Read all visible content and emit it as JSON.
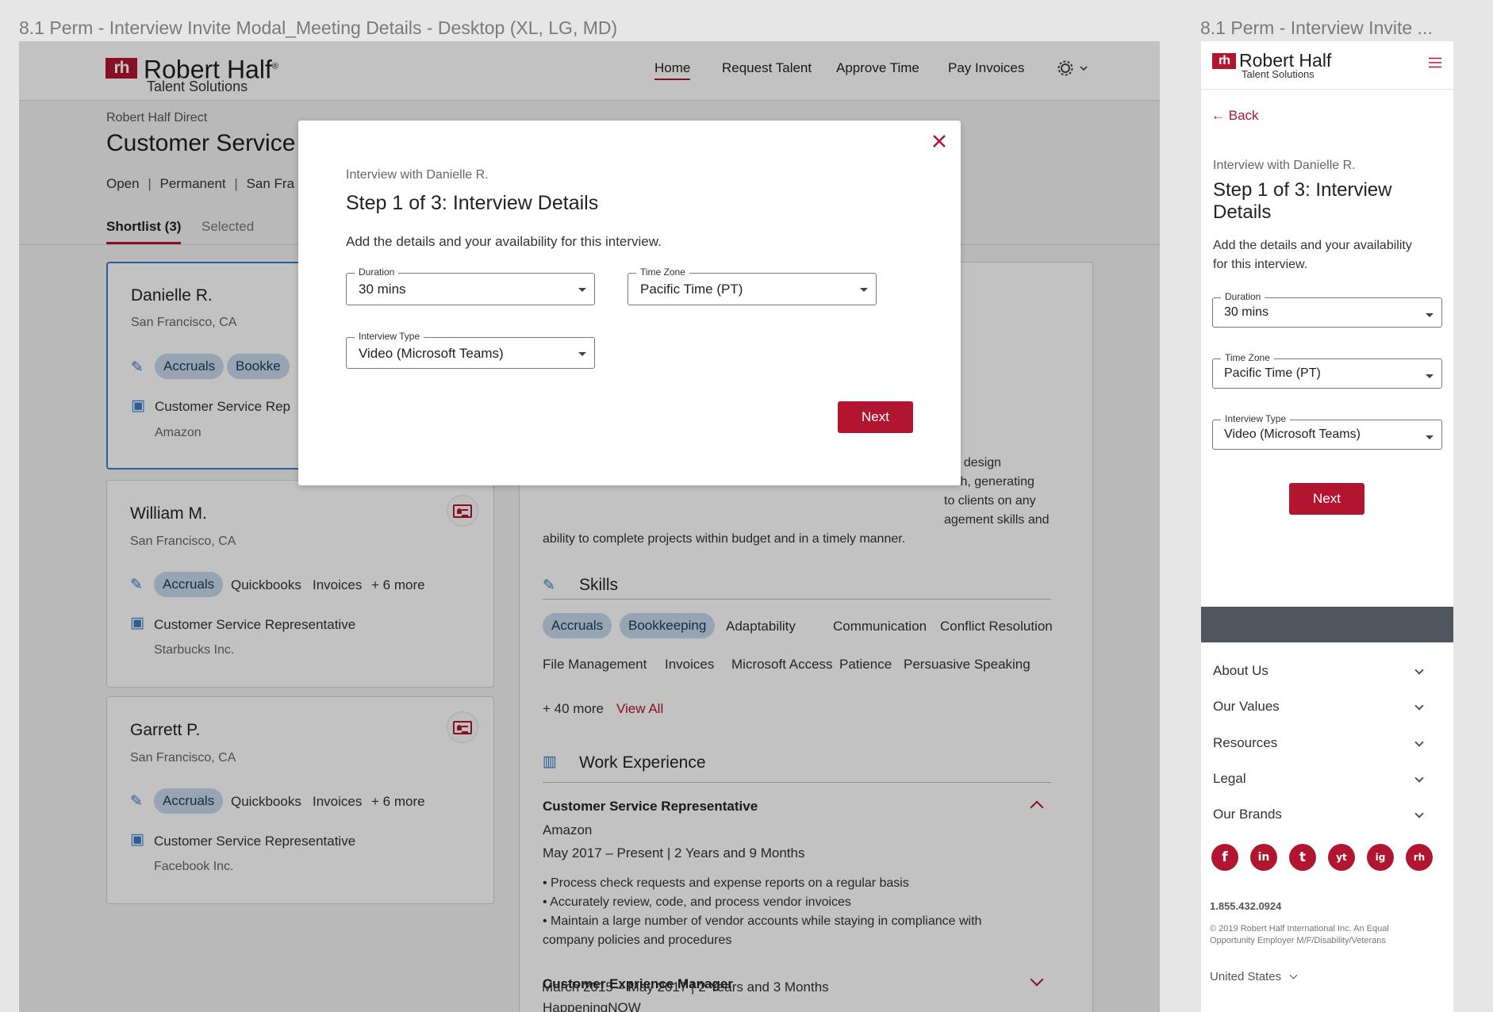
{
  "artboards": {
    "desktop_title": "8.1 Perm - Interview Invite Modal_Meeting Details - Desktop (XL, LG, MD)",
    "mobile_title": "8.1 Perm - Interview Invite ..."
  },
  "brand": {
    "logo_mark": "rh",
    "name": "Robert Half",
    "registered": "®",
    "sub": "Talent Solutions",
    "primary_color": "#b1152f",
    "chip_color": "#c5d8ec",
    "accent_icon_color": "#3b7cc4"
  },
  "nav": {
    "items": [
      "Home",
      "Request Talent",
      "Approve Time",
      "Pay Invoices"
    ],
    "active": "Home",
    "settings_icon": "gear-icon"
  },
  "job": {
    "breadcrumb": "Robert Half Direct",
    "title": "Customer Service",
    "status": "Open",
    "type": "Permanent",
    "location": "San Fra",
    "sep": "|"
  },
  "tabs": {
    "shortlist": "Shortlist (3)",
    "selected": "Selected"
  },
  "candidates": [
    {
      "name": "Danielle R.",
      "location": "San Francisco, CA",
      "chips": [
        "Accruals",
        "Bookke"
      ],
      "tags": [],
      "more": "",
      "title": "Customer Service Rep",
      "company": "Amazon"
    },
    {
      "name": "William M.",
      "location": "San Francisco, CA",
      "chips": [
        "Accruals"
      ],
      "tags": [
        "Quickbooks",
        "Invoices"
      ],
      "more": "+ 6 more",
      "title": "Customer Service Representative",
      "company": "Starbucks Inc."
    },
    {
      "name": "Garrett P.",
      "location": "San Francisco, CA",
      "chips": [
        "Accruals"
      ],
      "tags": [
        "Quickbooks",
        "Invoices"
      ],
      "more": "+ 6 more",
      "title": "Customer Service Representative",
      "company": "Facebook Inc."
    }
  ],
  "detail": {
    "summary_lines": [
      "hic design",
      "nish, generating",
      "to clients on any",
      "agement skills and",
      "ability to complete projects within budget and in a timely manner."
    ],
    "skills_title": "Skills",
    "skill_chips": [
      "Accruals",
      "Bookkeeping"
    ],
    "skills_row1": [
      "Adaptability",
      "Communication",
      "Conflict Resolution"
    ],
    "skills_row2": [
      "File Management",
      "Invoices",
      "Microsoft Access",
      "Patience",
      "Persuasive Speaking"
    ],
    "more": "+ 40 more",
    "view_all": "View All",
    "work_title": "Work Experience",
    "jobs": [
      {
        "title": "Customer Service Representative",
        "company": "Amazon",
        "dates": "May 2017 – Present  |  2 Years and 9 Months",
        "bullets": [
          "• Process check requests and expense reports on a regular basis",
          "• Accurately review, code, and process vendor invoices",
          "• Maintain a large number of vendor accounts while staying in compliance with",
          "company policies and procedures"
        ]
      },
      {
        "title": "Customer Exprience Manager",
        "company": "HappeningNOW",
        "dates": "March 2015 – May 2017  |  2 Years and 3 Months",
        "bullets": []
      }
    ]
  },
  "modal": {
    "eyebrow": "Interview with Danielle R.",
    "title": "Step 1 of 3: Interview Details",
    "desc": "Add the details and your availability for this interview.",
    "duration": {
      "label": "Duration",
      "value": "30 mins"
    },
    "timezone": {
      "label": "Time Zone",
      "value": "Pacific Time (PT)"
    },
    "interview_type": {
      "label": "Interview Type",
      "value": "Video (Microsoft Teams)"
    },
    "next": "Next",
    "close_icon": "close-icon"
  },
  "mobile": {
    "back": "Back",
    "eyebrow": "Interview with Danielle R.",
    "title_line1": "Step 1 of 3: Interview",
    "title_line2": "Details",
    "desc_line1": "Add the details and your availability",
    "desc_line2": "for this interview.",
    "duration": {
      "label": "Duration",
      "value": "30 mins"
    },
    "timezone": {
      "label": "Time Zone",
      "value": "Pacific Time (PT)"
    },
    "interview_type": {
      "label": "Interview Type",
      "value": "Video (Microsoft Teams)"
    },
    "next": "Next",
    "footer_links": [
      "About Us",
      "Our Values",
      "Resources",
      "Legal",
      "Our Brands"
    ],
    "social": [
      "f",
      "in",
      "t",
      "yt",
      "ig",
      "rh"
    ],
    "phone": "1.855.432.0924",
    "copyright_line1": "© 2019 Robert Half International Inc. An Equal",
    "copyright_line2": "Opportunity Employer M/F/Disability/Veterans",
    "country": "United States"
  }
}
